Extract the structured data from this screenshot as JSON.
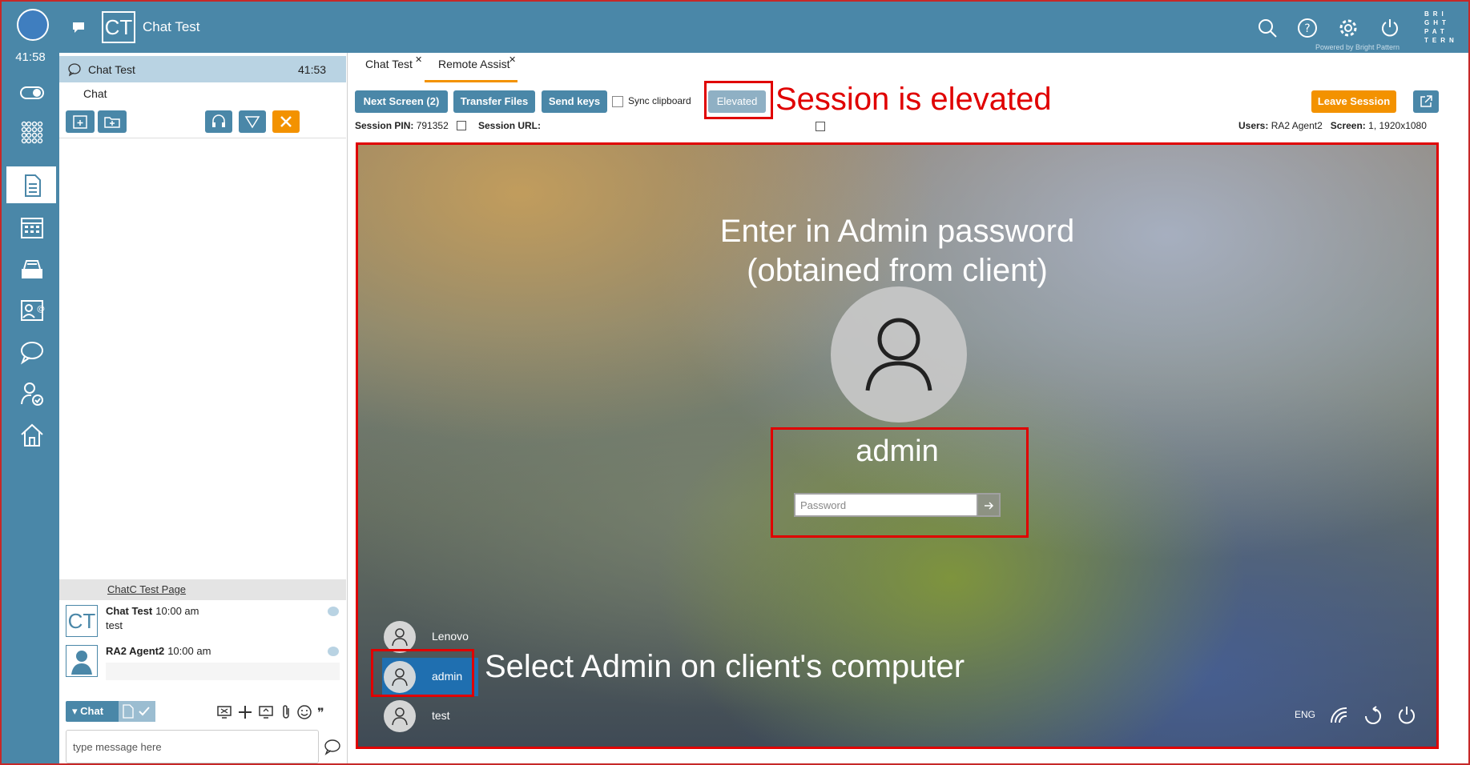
{
  "topbar": {
    "avatar_initials": "CT",
    "title": "Chat Test",
    "brand": "BRI GHT PAT TERN",
    "powered_by": "Powered by Bright Pattern",
    "icons": [
      "search-icon",
      "help-icon",
      "settings-icon",
      "power-icon"
    ]
  },
  "rail": {
    "timer": "41:58",
    "items": [
      "toggle-icon",
      "dialpad-icon",
      "contact-info-icon",
      "calendar-icon",
      "inbox-icon",
      "directory-icon",
      "chat-icon",
      "agent-status-icon",
      "home-icon"
    ]
  },
  "chat_panel": {
    "header_label": "Chat Test",
    "header_time": "41:53",
    "subtitle": "Chat",
    "page_title": "ChatC Test Page",
    "messages": [
      {
        "avatar": "CT",
        "name": "Chat Test",
        "time": "10:00 am",
        "text": "test"
      },
      {
        "avatar": "person-icon",
        "name": "RA2 Agent2",
        "time": "10:00 am",
        "text": ""
      }
    ],
    "chat_dropdown": "Chat",
    "message_placeholder": "type message here"
  },
  "main": {
    "tabs": [
      {
        "label": "Chat Test",
        "active": false
      },
      {
        "label": "Remote Assist",
        "active": true
      }
    ],
    "buttons": {
      "next_screen": "Next Screen (2)",
      "transfer_files": "Transfer Files",
      "send_keys": "Send keys",
      "sync_clipboard": "Sync clipboard",
      "elevated": "Elevated",
      "leave_session": "Leave Session"
    },
    "session_pin_label": "Session PIN:",
    "session_pin": "791352",
    "session_url_label": "Session URL:",
    "users_label": "Users:",
    "users_value": "RA2 Agent2",
    "screen_label": "Screen:",
    "screen_value": "1, 1920x1080"
  },
  "annotations": {
    "elevated": "Session is elevated",
    "enter_password_line1": "Enter in Admin password",
    "enter_password_line2": "(obtained from client)",
    "select_admin": "Select Admin on client's computer"
  },
  "remote_screen": {
    "username": "admin",
    "password_placeholder": "Password",
    "users": [
      "Lenovo",
      "admin",
      "test"
    ],
    "selected_user": "admin",
    "language": "ENG"
  },
  "colors": {
    "primary": "#4a87a8",
    "accent": "#f39200",
    "annotation": "#e00000"
  }
}
